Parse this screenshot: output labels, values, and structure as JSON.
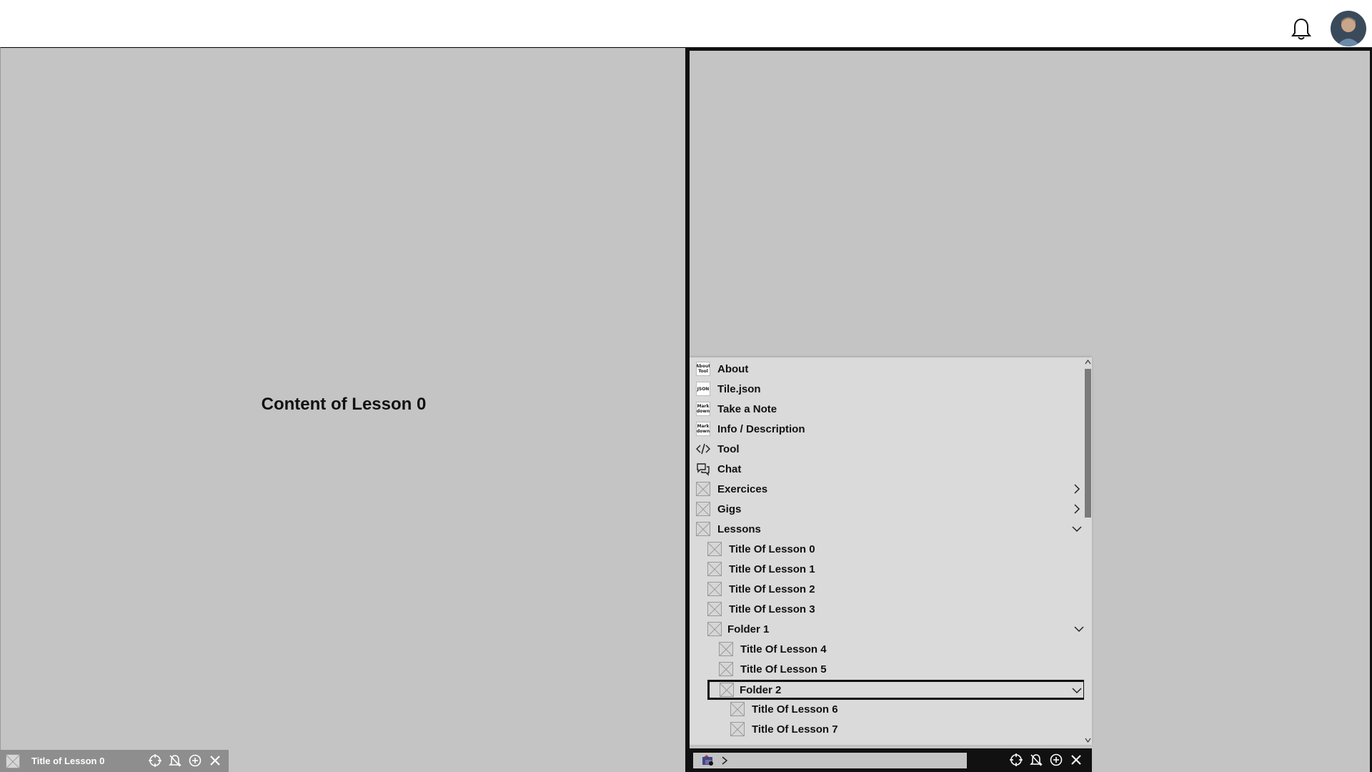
{
  "header": {
    "notifications_icon": "bell-icon",
    "avatar_icon": "user-avatar"
  },
  "left_pane": {
    "content_text": "Content of Lesson 0"
  },
  "left_tab": {
    "title": "Title of Lesson 0",
    "icons": [
      "crosshair-icon",
      "bell-off-icon",
      "plus-circle-icon",
      "close-icon"
    ]
  },
  "menu": {
    "items": [
      {
        "label": "About",
        "icon": "about-tool-icon",
        "icon_text": "About Tool"
      },
      {
        "label": "Tile.json",
        "icon": "json-icon",
        "icon_text": "JSON"
      },
      {
        "label": "Take a Note",
        "icon": "markdown-icon",
        "icon_text": "Mark down"
      },
      {
        "label": "Info / Description",
        "icon": "markdown-icon",
        "icon_text": "Mark down"
      },
      {
        "label": "Tool",
        "icon": "code-icon"
      },
      {
        "label": "Chat",
        "icon": "chat-icon"
      },
      {
        "label": "Exercices",
        "icon": "placeholder-icon",
        "chevron": "right"
      },
      {
        "label": "Gigs",
        "icon": "placeholder-icon",
        "chevron": "right"
      },
      {
        "label": "Lessons",
        "icon": "placeholder-icon",
        "chevron": "down"
      },
      {
        "label": "Title Of Lesson 0",
        "icon": "placeholder-icon"
      },
      {
        "label": "Title Of Lesson 1",
        "icon": "placeholder-icon"
      },
      {
        "label": "Title Of Lesson 2",
        "icon": "placeholder-icon"
      },
      {
        "label": "Title Of Lesson 3",
        "icon": "placeholder-icon"
      },
      {
        "label": "Folder 1",
        "icon": "placeholder-icon",
        "chevron": "down"
      },
      {
        "label": "Title Of Lesson 4",
        "icon": "placeholder-icon"
      },
      {
        "label": "Title Of Lesson 5",
        "icon": "placeholder-icon"
      },
      {
        "label": "Folder 2",
        "icon": "placeholder-icon",
        "chevron": "down",
        "selected": true
      },
      {
        "label": "Title Of Lesson 6",
        "icon": "placeholder-icon"
      },
      {
        "label": "Title Of Lesson 7",
        "icon": "placeholder-icon"
      }
    ]
  },
  "right_tab": {
    "address_icon": "app-logo-icon",
    "prompt_symbol": ">",
    "icons": [
      "crosshair-icon",
      "bell-off-icon",
      "plus-circle-icon",
      "close-icon"
    ]
  },
  "colors": {
    "pane_bg": "#c4c4c4",
    "menu_bg": "#dadada",
    "border": "#111111"
  }
}
